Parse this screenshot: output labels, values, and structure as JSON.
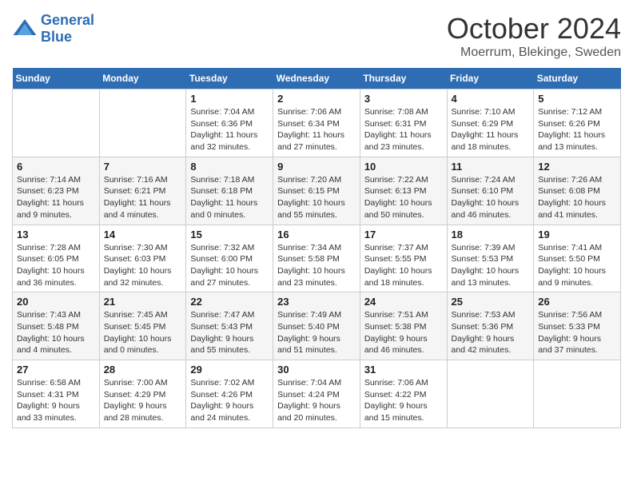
{
  "header": {
    "logo_line1": "General",
    "logo_line2": "Blue",
    "month": "October 2024",
    "location": "Moerrum, Blekinge, Sweden"
  },
  "weekdays": [
    "Sunday",
    "Monday",
    "Tuesday",
    "Wednesday",
    "Thursday",
    "Friday",
    "Saturday"
  ],
  "weeks": [
    [
      {
        "day": "",
        "sunrise": "",
        "sunset": "",
        "daylight": ""
      },
      {
        "day": "",
        "sunrise": "",
        "sunset": "",
        "daylight": ""
      },
      {
        "day": "1",
        "sunrise": "Sunrise: 7:04 AM",
        "sunset": "Sunset: 6:36 PM",
        "daylight": "Daylight: 11 hours and 32 minutes."
      },
      {
        "day": "2",
        "sunrise": "Sunrise: 7:06 AM",
        "sunset": "Sunset: 6:34 PM",
        "daylight": "Daylight: 11 hours and 27 minutes."
      },
      {
        "day": "3",
        "sunrise": "Sunrise: 7:08 AM",
        "sunset": "Sunset: 6:31 PM",
        "daylight": "Daylight: 11 hours and 23 minutes."
      },
      {
        "day": "4",
        "sunrise": "Sunrise: 7:10 AM",
        "sunset": "Sunset: 6:29 PM",
        "daylight": "Daylight: 11 hours and 18 minutes."
      },
      {
        "day": "5",
        "sunrise": "Sunrise: 7:12 AM",
        "sunset": "Sunset: 6:26 PM",
        "daylight": "Daylight: 11 hours and 13 minutes."
      }
    ],
    [
      {
        "day": "6",
        "sunrise": "Sunrise: 7:14 AM",
        "sunset": "Sunset: 6:23 PM",
        "daylight": "Daylight: 11 hours and 9 minutes."
      },
      {
        "day": "7",
        "sunrise": "Sunrise: 7:16 AM",
        "sunset": "Sunset: 6:21 PM",
        "daylight": "Daylight: 11 hours and 4 minutes."
      },
      {
        "day": "8",
        "sunrise": "Sunrise: 7:18 AM",
        "sunset": "Sunset: 6:18 PM",
        "daylight": "Daylight: 11 hours and 0 minutes."
      },
      {
        "day": "9",
        "sunrise": "Sunrise: 7:20 AM",
        "sunset": "Sunset: 6:15 PM",
        "daylight": "Daylight: 10 hours and 55 minutes."
      },
      {
        "day": "10",
        "sunrise": "Sunrise: 7:22 AM",
        "sunset": "Sunset: 6:13 PM",
        "daylight": "Daylight: 10 hours and 50 minutes."
      },
      {
        "day": "11",
        "sunrise": "Sunrise: 7:24 AM",
        "sunset": "Sunset: 6:10 PM",
        "daylight": "Daylight: 10 hours and 46 minutes."
      },
      {
        "day": "12",
        "sunrise": "Sunrise: 7:26 AM",
        "sunset": "Sunset: 6:08 PM",
        "daylight": "Daylight: 10 hours and 41 minutes."
      }
    ],
    [
      {
        "day": "13",
        "sunrise": "Sunrise: 7:28 AM",
        "sunset": "Sunset: 6:05 PM",
        "daylight": "Daylight: 10 hours and 36 minutes."
      },
      {
        "day": "14",
        "sunrise": "Sunrise: 7:30 AM",
        "sunset": "Sunset: 6:03 PM",
        "daylight": "Daylight: 10 hours and 32 minutes."
      },
      {
        "day": "15",
        "sunrise": "Sunrise: 7:32 AM",
        "sunset": "Sunset: 6:00 PM",
        "daylight": "Daylight: 10 hours and 27 minutes."
      },
      {
        "day": "16",
        "sunrise": "Sunrise: 7:34 AM",
        "sunset": "Sunset: 5:58 PM",
        "daylight": "Daylight: 10 hours and 23 minutes."
      },
      {
        "day": "17",
        "sunrise": "Sunrise: 7:37 AM",
        "sunset": "Sunset: 5:55 PM",
        "daylight": "Daylight: 10 hours and 18 minutes."
      },
      {
        "day": "18",
        "sunrise": "Sunrise: 7:39 AM",
        "sunset": "Sunset: 5:53 PM",
        "daylight": "Daylight: 10 hours and 13 minutes."
      },
      {
        "day": "19",
        "sunrise": "Sunrise: 7:41 AM",
        "sunset": "Sunset: 5:50 PM",
        "daylight": "Daylight: 10 hours and 9 minutes."
      }
    ],
    [
      {
        "day": "20",
        "sunrise": "Sunrise: 7:43 AM",
        "sunset": "Sunset: 5:48 PM",
        "daylight": "Daylight: 10 hours and 4 minutes."
      },
      {
        "day": "21",
        "sunrise": "Sunrise: 7:45 AM",
        "sunset": "Sunset: 5:45 PM",
        "daylight": "Daylight: 10 hours and 0 minutes."
      },
      {
        "day": "22",
        "sunrise": "Sunrise: 7:47 AM",
        "sunset": "Sunset: 5:43 PM",
        "daylight": "Daylight: 9 hours and 55 minutes."
      },
      {
        "day": "23",
        "sunrise": "Sunrise: 7:49 AM",
        "sunset": "Sunset: 5:40 PM",
        "daylight": "Daylight: 9 hours and 51 minutes."
      },
      {
        "day": "24",
        "sunrise": "Sunrise: 7:51 AM",
        "sunset": "Sunset: 5:38 PM",
        "daylight": "Daylight: 9 hours and 46 minutes."
      },
      {
        "day": "25",
        "sunrise": "Sunrise: 7:53 AM",
        "sunset": "Sunset: 5:36 PM",
        "daylight": "Daylight: 9 hours and 42 minutes."
      },
      {
        "day": "26",
        "sunrise": "Sunrise: 7:56 AM",
        "sunset": "Sunset: 5:33 PM",
        "daylight": "Daylight: 9 hours and 37 minutes."
      }
    ],
    [
      {
        "day": "27",
        "sunrise": "Sunrise: 6:58 AM",
        "sunset": "Sunset: 4:31 PM",
        "daylight": "Daylight: 9 hours and 33 minutes."
      },
      {
        "day": "28",
        "sunrise": "Sunrise: 7:00 AM",
        "sunset": "Sunset: 4:29 PM",
        "daylight": "Daylight: 9 hours and 28 minutes."
      },
      {
        "day": "29",
        "sunrise": "Sunrise: 7:02 AM",
        "sunset": "Sunset: 4:26 PM",
        "daylight": "Daylight: 9 hours and 24 minutes."
      },
      {
        "day": "30",
        "sunrise": "Sunrise: 7:04 AM",
        "sunset": "Sunset: 4:24 PM",
        "daylight": "Daylight: 9 hours and 20 minutes."
      },
      {
        "day": "31",
        "sunrise": "Sunrise: 7:06 AM",
        "sunset": "Sunset: 4:22 PM",
        "daylight": "Daylight: 9 hours and 15 minutes."
      },
      {
        "day": "",
        "sunrise": "",
        "sunset": "",
        "daylight": ""
      },
      {
        "day": "",
        "sunrise": "",
        "sunset": "",
        "daylight": ""
      }
    ]
  ]
}
